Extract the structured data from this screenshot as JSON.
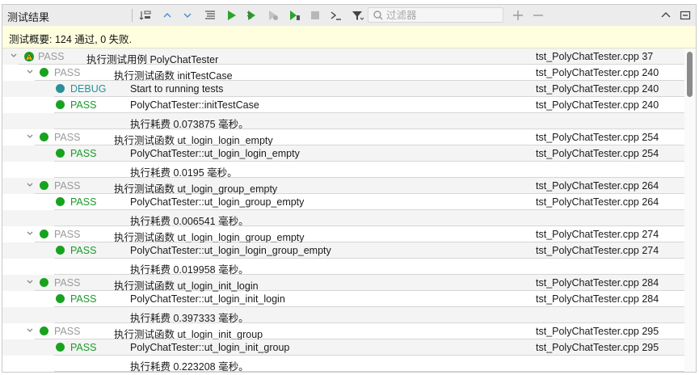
{
  "toolbar": {
    "title": "测试结果",
    "filter_placeholder": "过滤器",
    "icons": [
      "sort-icon",
      "expand-up-icon",
      "expand-down-icon",
      "tree-list-icon",
      "run-all-icon",
      "run-selected-icon",
      "run-failed-icon",
      "run-file-icon",
      "stop-icon",
      "output-icon",
      "filter-icon",
      "add-icon",
      "remove-icon",
      "collapse-panel-icon",
      "maximize-panel-icon"
    ]
  },
  "summary": "测试概要: 124 通过, 0 失败.",
  "colors": {
    "pass_green": "#1a9a28",
    "pass_dot": "#17a31e",
    "debug_teal": "#2a8f98",
    "muted_gray": "#9a9a9a"
  },
  "rows": [
    {
      "level": 0,
      "caret": true,
      "icon": "warn-pass",
      "status": "PASS",
      "muted": true,
      "desc": "执行测试用例 PolyChatTester",
      "file": "tst_PolyChatTester.cpp 37"
    },
    {
      "level": 1,
      "caret": true,
      "icon": "pass",
      "status": "PASS",
      "muted": true,
      "desc": "执行测试函数 initTestCase",
      "file": "tst_PolyChatTester.cpp 240"
    },
    {
      "level": 2,
      "caret": false,
      "icon": "debug",
      "status": "DEBUG",
      "muted": false,
      "desc": "Start to running tests",
      "file": "tst_PolyChatTester.cpp 240"
    },
    {
      "level": 2,
      "caret": false,
      "icon": "pass",
      "status": "PASS",
      "muted": false,
      "desc": "PolyChatTester::initTestCase",
      "file": "tst_PolyChatTester.cpp 240"
    },
    {
      "level": 2,
      "caret": false,
      "icon": "",
      "status": "",
      "muted": false,
      "desc": "执行耗费 0.073875 毫秒。",
      "file": ""
    },
    {
      "level": 1,
      "caret": true,
      "icon": "pass",
      "status": "PASS",
      "muted": true,
      "desc": "执行测试函数 ut_login_login_empty",
      "file": "tst_PolyChatTester.cpp 254"
    },
    {
      "level": 2,
      "caret": false,
      "icon": "pass",
      "status": "PASS",
      "muted": false,
      "desc": "PolyChatTester::ut_login_login_empty",
      "file": "tst_PolyChatTester.cpp 254"
    },
    {
      "level": 2,
      "caret": false,
      "icon": "",
      "status": "",
      "muted": false,
      "desc": "执行耗费 0.0195 毫秒。",
      "file": ""
    },
    {
      "level": 1,
      "caret": true,
      "icon": "pass",
      "status": "PASS",
      "muted": true,
      "desc": "执行测试函数 ut_login_group_empty",
      "file": "tst_PolyChatTester.cpp 264"
    },
    {
      "level": 2,
      "caret": false,
      "icon": "pass",
      "status": "PASS",
      "muted": false,
      "desc": "PolyChatTester::ut_login_group_empty",
      "file": "tst_PolyChatTester.cpp 264"
    },
    {
      "level": 2,
      "caret": false,
      "icon": "",
      "status": "",
      "muted": false,
      "desc": "执行耗费 0.006541 毫秒。",
      "file": ""
    },
    {
      "level": 1,
      "caret": true,
      "icon": "pass",
      "status": "PASS",
      "muted": true,
      "desc": "执行测试函数 ut_login_login_group_empty",
      "file": "tst_PolyChatTester.cpp 274"
    },
    {
      "level": 2,
      "caret": false,
      "icon": "pass",
      "status": "PASS",
      "muted": false,
      "desc": "PolyChatTester::ut_login_login_group_empty",
      "file": "tst_PolyChatTester.cpp 274"
    },
    {
      "level": 2,
      "caret": false,
      "icon": "",
      "status": "",
      "muted": false,
      "desc": "执行耗费 0.019958 毫秒。",
      "file": ""
    },
    {
      "level": 1,
      "caret": true,
      "icon": "pass",
      "status": "PASS",
      "muted": true,
      "desc": "执行测试函数 ut_login_init_login",
      "file": "tst_PolyChatTester.cpp 284"
    },
    {
      "level": 2,
      "caret": false,
      "icon": "pass",
      "status": "PASS",
      "muted": false,
      "desc": "PolyChatTester::ut_login_init_login",
      "file": "tst_PolyChatTester.cpp 284"
    },
    {
      "level": 2,
      "caret": false,
      "icon": "",
      "status": "",
      "muted": false,
      "desc": "执行耗费 0.397333 毫秒。",
      "file": ""
    },
    {
      "level": 1,
      "caret": true,
      "icon": "pass",
      "status": "PASS",
      "muted": true,
      "desc": "执行测试函数 ut_login_init_group",
      "file": "tst_PolyChatTester.cpp 295"
    },
    {
      "level": 2,
      "caret": false,
      "icon": "pass",
      "status": "PASS",
      "muted": false,
      "desc": "PolyChatTester::ut_login_init_group",
      "file": "tst_PolyChatTester.cpp 295"
    },
    {
      "level": 2,
      "caret": false,
      "icon": "",
      "status": "",
      "muted": false,
      "desc": "执行耗费 0.223208 毫秒。",
      "file": ""
    }
  ]
}
